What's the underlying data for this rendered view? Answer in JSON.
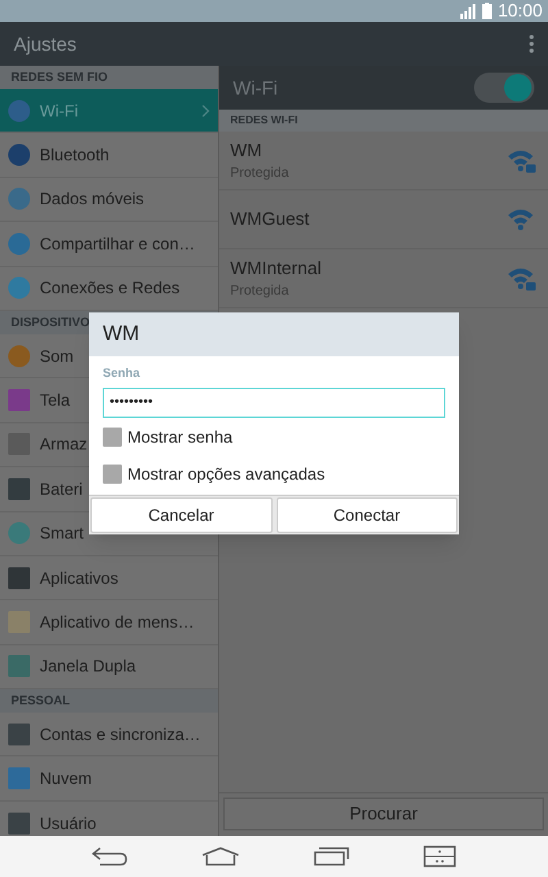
{
  "status_bar": {
    "time": "10:00"
  },
  "app_bar": {
    "title": "Ajustes"
  },
  "sidebar": {
    "sections": [
      {
        "title": "REDES SEM FIO",
        "items": [
          {
            "label": "Wi-Fi",
            "selected": true
          },
          {
            "label": "Bluetooth",
            "selected": false
          },
          {
            "label": "Dados móveis",
            "selected": false
          },
          {
            "label": "Compartilhar e con…",
            "selected": false
          },
          {
            "label": "Conexões e Redes",
            "selected": false
          }
        ]
      },
      {
        "title": "DISPOSITIVO",
        "items": [
          {
            "label": "Som",
            "selected": false
          },
          {
            "label": "Tela",
            "selected": false
          },
          {
            "label": "Armaz",
            "selected": false
          },
          {
            "label": "Bateri",
            "selected": false
          },
          {
            "label": "Smart",
            "selected": false
          },
          {
            "label": "Aplicativos",
            "selected": false
          },
          {
            "label": "Aplicativo de mens…",
            "selected": false
          },
          {
            "label": "Janela Dupla",
            "selected": false
          }
        ]
      },
      {
        "title": "PESSOAL",
        "items": [
          {
            "label": "Contas e sincroniza…",
            "selected": false
          },
          {
            "label": "Nuvem",
            "selected": false
          },
          {
            "label": "Usuário",
            "selected": false
          }
        ]
      }
    ]
  },
  "wifi_panel": {
    "title": "Wi-Fi",
    "on": true,
    "section_title": "REDES WI-FI",
    "networks": [
      {
        "name": "WM",
        "status": "Protegida",
        "locked": true
      },
      {
        "name": "WMGuest",
        "locked": false
      },
      {
        "name": "WMInternal",
        "status": "Protegida",
        "locked": true
      }
    ],
    "scan_button": "Procurar"
  },
  "dialog": {
    "title": "WM",
    "field_label": "Senha",
    "password": "•••••••••",
    "checkboxes": [
      {
        "label": "Mostrar senha",
        "checked": false
      },
      {
        "label": "Mostrar opções avançadas",
        "checked": false
      }
    ],
    "buttons": [
      "Cancelar",
      "Conectar"
    ]
  }
}
